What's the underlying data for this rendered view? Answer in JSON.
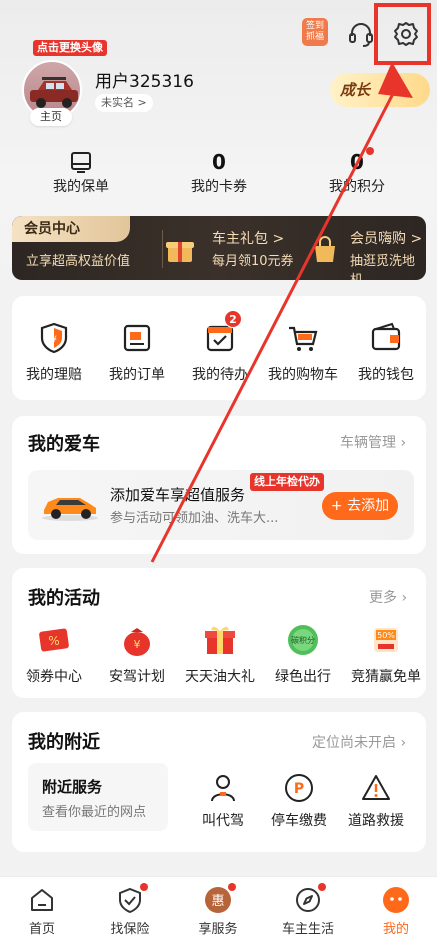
{
  "top": {
    "signin_line1": "签到",
    "signin_line2": "抓福"
  },
  "profile": {
    "avatar_tag": "点击更换头像",
    "avatar_home": "主页",
    "username": "用户325316",
    "verify": "未实名 >",
    "growth": "成长"
  },
  "stats": [
    {
      "value": "",
      "label": "我的保单"
    },
    {
      "value": "0",
      "label": "我的卡券"
    },
    {
      "value": "0",
      "label": "我的积分"
    }
  ],
  "membership": {
    "title": "会员中心",
    "subtitle": "立享超高权益价值",
    "gift_title": "车主礼包 >",
    "gift_sub": "每月领10元券",
    "buy_title": "会员嗨购 >",
    "buy_sub": "抽逛觅洗地机"
  },
  "quick_actions": [
    {
      "label": "我的理赔",
      "icon": "claim-shield-icon"
    },
    {
      "label": "我的订单",
      "icon": "order-icon"
    },
    {
      "label": "我的待办",
      "icon": "todo-icon",
      "badge": "2"
    },
    {
      "label": "我的购物车",
      "icon": "cart-icon"
    },
    {
      "label": "我的钱包",
      "icon": "wallet-icon"
    }
  ],
  "my_car": {
    "title": "我的爱车",
    "manage": "车辆管理",
    "add_title": "添加爱车享超值服务",
    "add_sub": "参与活动可领加油、洗车大...",
    "tag": "线上年检代办",
    "add_button": "+ 去添加"
  },
  "activities": {
    "title": "我的活动",
    "more": "更多",
    "items": [
      {
        "label": "领券中心",
        "icon": "coupon-icon"
      },
      {
        "label": "安驾计划",
        "icon": "money-bag-icon"
      },
      {
        "label": "天天油大礼",
        "icon": "gift-box-icon"
      },
      {
        "label": "绿色出行",
        "icon": "points-ball-icon",
        "icon_text": "碳积分"
      },
      {
        "label": "竞猜赢免单",
        "icon": "guess-icon",
        "icon_text": "50%"
      }
    ]
  },
  "nearby": {
    "title": "我的附近",
    "location_status": "定位尚未开启",
    "service_title": "附近服务",
    "service_sub": "查看你最近的网点",
    "items": [
      {
        "label": "叫代驾",
        "icon": "driver-icon"
      },
      {
        "label": "停车缴费",
        "icon": "parking-icon"
      },
      {
        "label": "道路救援",
        "icon": "warning-icon"
      }
    ]
  },
  "bottom_nav": [
    {
      "label": "首页",
      "icon": "home-icon",
      "dot": false
    },
    {
      "label": "找保险",
      "icon": "insurance-icon",
      "dot": true
    },
    {
      "label": "享服务",
      "icon": "service-icon",
      "dot": true,
      "icon_text": "惠"
    },
    {
      "label": "车主生活",
      "icon": "compass-icon",
      "dot": true
    },
    {
      "label": "我的",
      "icon": "mine-icon",
      "dot": false
    }
  ],
  "colors": {
    "accent": "#ff6a1a",
    "alert_red": "#e8352c",
    "member_dark": "#2d2622",
    "member_gold": "#f4dcb4"
  }
}
